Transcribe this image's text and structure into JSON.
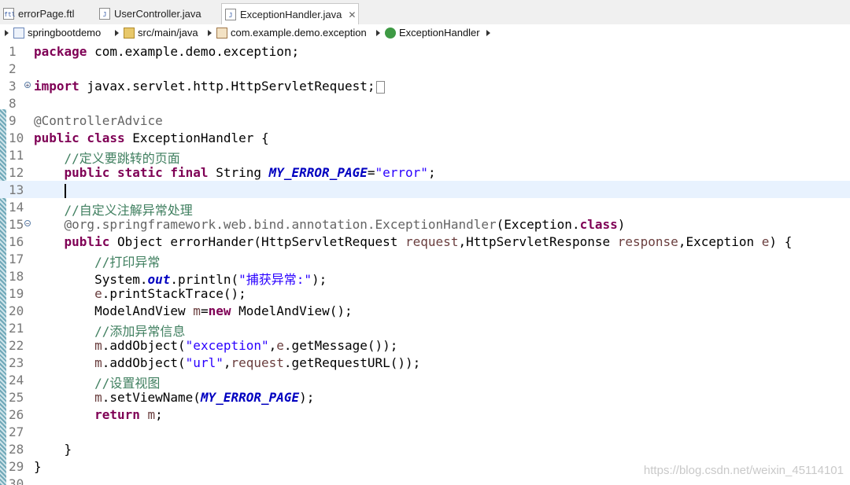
{
  "tabs": [
    {
      "label": "errorPage.ftl",
      "icon": "ftl-file-icon"
    },
    {
      "label": "UserController.java",
      "icon": "java-file-icon"
    },
    {
      "label": "ExceptionHandler.java",
      "icon": "java-file-icon",
      "active": true,
      "close": "✕"
    }
  ],
  "breadcrumb": {
    "project": "springbootdemo",
    "folder": "src/main/java",
    "package": "com.example.demo.exception",
    "class": "ExceptionHandler"
  },
  "editor": {
    "current_line": 13,
    "lines": [
      {
        "n": "1"
      },
      {
        "n": "2"
      },
      {
        "n": "3"
      },
      {
        "n": "8"
      },
      {
        "n": "9"
      },
      {
        "n": "10"
      },
      {
        "n": "11"
      },
      {
        "n": "12"
      },
      {
        "n": "13"
      },
      {
        "n": "14"
      },
      {
        "n": "15"
      },
      {
        "n": "16"
      },
      {
        "n": "17"
      },
      {
        "n": "18"
      },
      {
        "n": "19"
      },
      {
        "n": "20"
      },
      {
        "n": "21"
      },
      {
        "n": "22"
      },
      {
        "n": "23"
      },
      {
        "n": "24"
      },
      {
        "n": "25"
      },
      {
        "n": "26"
      },
      {
        "n": "27"
      },
      {
        "n": "28"
      },
      {
        "n": "29"
      },
      {
        "n": "30"
      }
    ],
    "code": {
      "l1_kw": "package",
      "l1_rest": " com.example.demo.exception;",
      "l3_kw": "import",
      "l3_rest": " javax.servlet.http.HttpServletRequest;",
      "l9": "@ControllerAdvice",
      "l10_kw": "public class",
      "l10_rest": " ExceptionHandler {",
      "l11": "//定义要跳转的页面",
      "l12_kw": "public static final",
      "l12_type": " String ",
      "l12_field": "MY_ERROR_PAGE",
      "l12_eq": "=",
      "l12_str": "\"error\"",
      "l12_end": ";",
      "l14": "//自定义注解异常处理",
      "l15_ann": "@org.springframework.web.bind.annotation.",
      "l15_ann2": "ExceptionHandler",
      "l15_rest": "(Exception.",
      "l15_kw": "class",
      "l15_end": ")",
      "l16_kw": "public",
      "l16_a": " Object errorHander(HttpServletRequest ",
      "l16_v1": "request",
      "l16_b": ",HttpServletResponse ",
      "l16_v2": "response",
      "l16_c": ",Exception ",
      "l16_v3": "e",
      "l16_d": ") {",
      "l17": "//打印异常",
      "l18_a": "System.",
      "l18_field": "out",
      "l18_b": ".println(",
      "l18_str": "\"捕获异常:\"",
      "l18_c": ");",
      "l19_v": "e",
      "l19_rest": ".printStackTrace();",
      "l20_a": "ModelAndView ",
      "l20_v": "m",
      "l20_b": "=",
      "l20_kw": "new",
      "l20_c": " ModelAndView();",
      "l21": "//添加异常信息",
      "l22_v": "m",
      "l22_a": ".addObject(",
      "l22_str": "\"exception\"",
      "l22_b": ",",
      "l22_v2": "e",
      "l22_c": ".getMessage());",
      "l23_v": "m",
      "l23_a": ".addObject(",
      "l23_str": "\"url\"",
      "l23_b": ",",
      "l23_v2": "request",
      "l23_c": ".getRequestURL());",
      "l24": "//设置视图",
      "l25_v": "m",
      "l25_a": ".setViewName(",
      "l25_field": "MY_ERROR_PAGE",
      "l25_b": ");",
      "l26_kw": "return",
      "l26_v": " m",
      "l26_b": ";",
      "l28": "}",
      "l29": "}"
    }
  },
  "watermark": "https://blog.csdn.net/weixin_45114101"
}
